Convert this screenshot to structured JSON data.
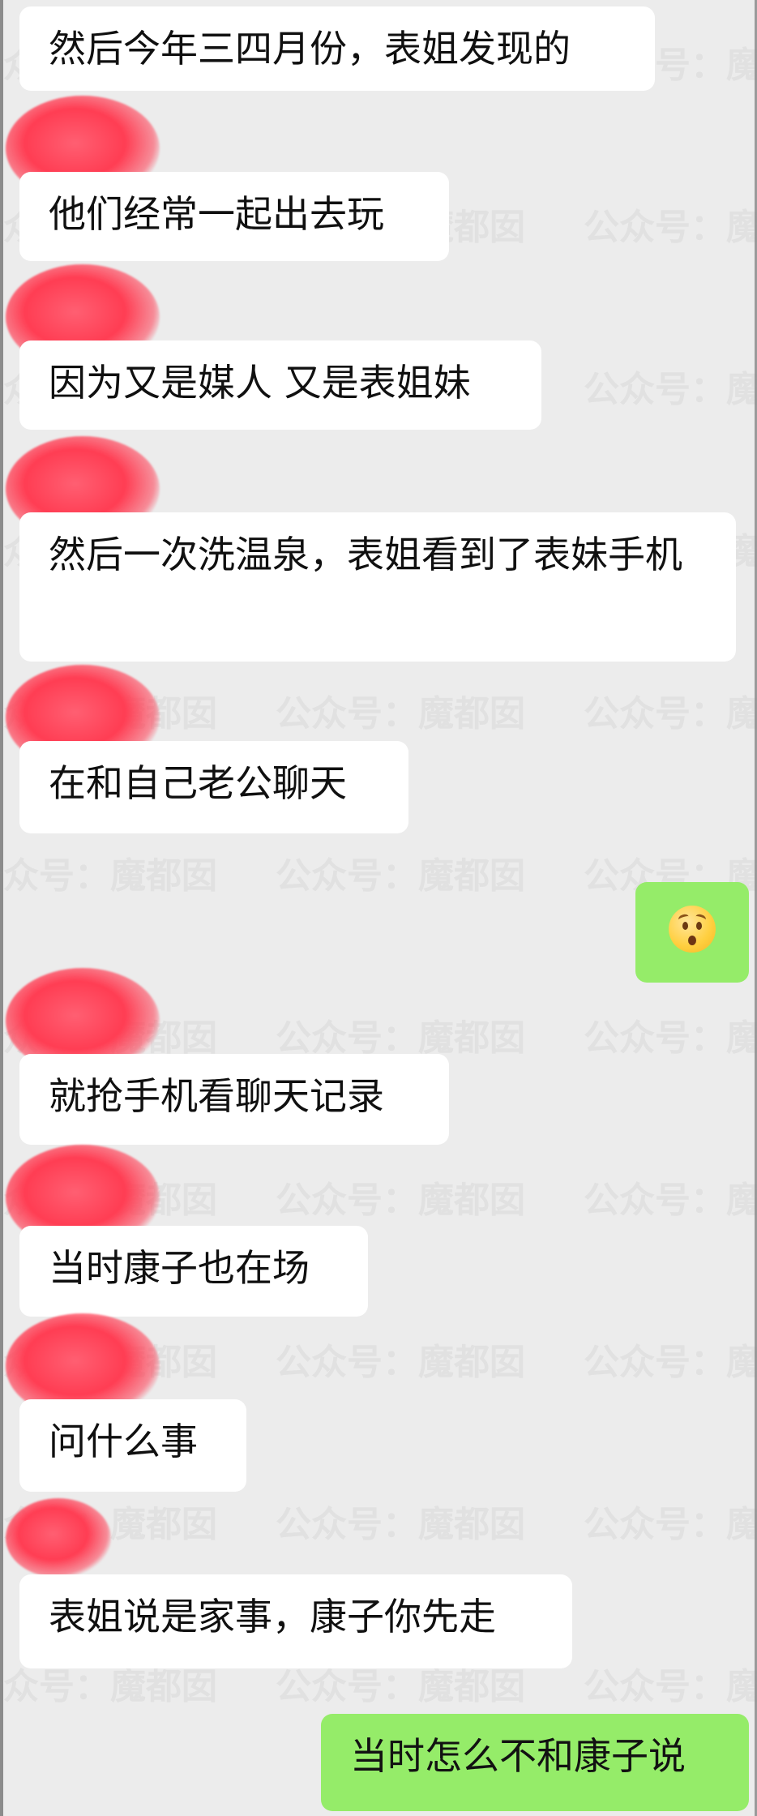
{
  "watermark_text": "公众号：魔都囡",
  "messages": [
    {
      "sender": "contact",
      "text": "然后今年三四月份，表姐发现的"
    },
    {
      "sender": "contact",
      "text": "他们经常一起出去玩"
    },
    {
      "sender": "contact",
      "text": "因为又是媒人 又是表姐妹"
    },
    {
      "sender": "contact",
      "text": "然后一次洗温泉，表姐看到了表妹手机"
    },
    {
      "sender": "contact",
      "text": "在和自己老公聊天"
    },
    {
      "sender": "me",
      "text": "😦",
      "icon": "worried-face-emoji-icon"
    },
    {
      "sender": "contact",
      "text": "就抢手机看聊天记录"
    },
    {
      "sender": "contact",
      "text": "当时康子也在场"
    },
    {
      "sender": "contact",
      "text": "问什么事"
    },
    {
      "sender": "contact",
      "text": "表姐说是家事，康子你先走"
    },
    {
      "sender": "me",
      "text": "当时怎么不和康子说"
    }
  ],
  "colors": {
    "background": "#ececec",
    "contact_bubble": "#ffffff",
    "my_bubble": "#95ec69",
    "avatar_blur": "#ff3d53"
  }
}
